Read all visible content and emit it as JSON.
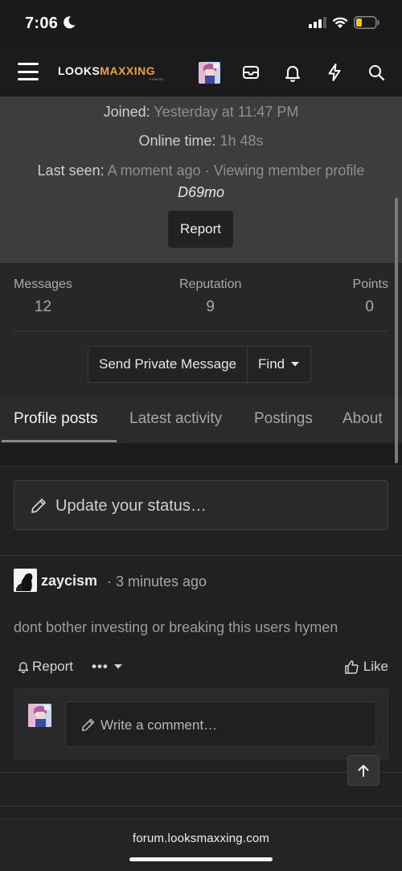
{
  "status_bar": {
    "time": "7:06",
    "battery_color": "#f5c518"
  },
  "navbar": {
    "logo_main": "LOOKS",
    "logo_accent": "MAXXING",
    "logo_sub": "FORUM",
    "accent_color": "#e8a33a"
  },
  "profile": {
    "joined_label": "Joined:",
    "joined_value": "Yesterday at 11:47 PM",
    "online_label": "Online time:",
    "online_value": "1h 48s",
    "last_seen_label": "Last seen:",
    "last_seen_value": "A moment ago · Viewing member profile",
    "member_name": "D69mo",
    "report_label": "Report"
  },
  "stats": {
    "messages_label": "Messages",
    "messages_value": "12",
    "reputation_label": "Reputation",
    "reputation_value": "9",
    "points_label": "Points",
    "points_value": "0"
  },
  "actions": {
    "send_pm_label": "Send Private Message",
    "find_label": "Find"
  },
  "tabs": [
    {
      "label": "Profile posts",
      "active": true
    },
    {
      "label": "Latest activity",
      "active": false
    },
    {
      "label": "Postings",
      "active": false
    },
    {
      "label": "About",
      "active": false
    }
  ],
  "status_update": {
    "placeholder": "Update your status…"
  },
  "post": {
    "author": "zaycism",
    "time": "· 3 minutes ago",
    "body": "dont bother investing or breaking this users hymen",
    "report_label": "Report",
    "more_label": "•••",
    "like_label": "Like"
  },
  "comment": {
    "placeholder": "Write a comment…"
  },
  "browser": {
    "url": "forum.looksmaxxing.com"
  }
}
